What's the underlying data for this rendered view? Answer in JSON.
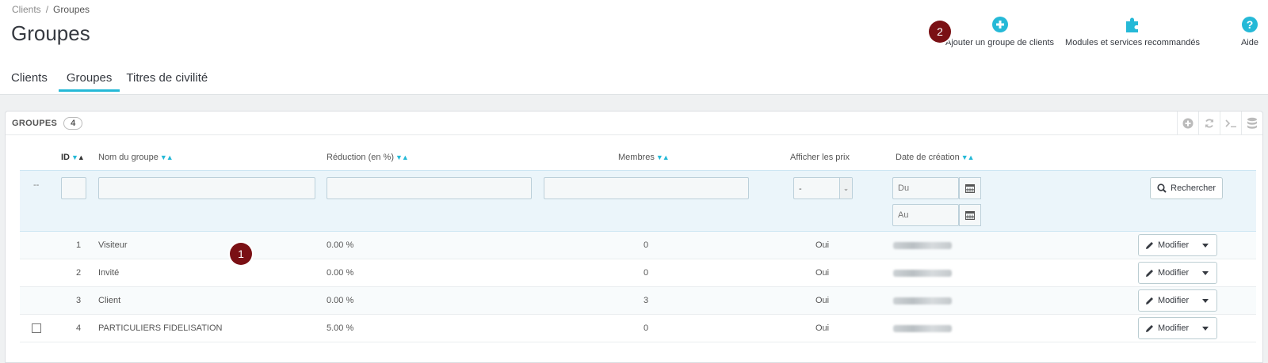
{
  "breadcrumb": {
    "parent": "Clients",
    "separator": "/",
    "current": "Groupes"
  },
  "page": {
    "title": "Groupes"
  },
  "toolbar": {
    "add_group": "Ajouter un groupe de clients",
    "modules": "Modules et services recommandés",
    "help": "Aide"
  },
  "tabs": [
    "Clients",
    "Groupes",
    "Titres de civilité"
  ],
  "markers": {
    "one": "1",
    "two": "2"
  },
  "panel": {
    "title": "GROUPES",
    "count": "4"
  },
  "columns": {
    "id": "ID",
    "name": "Nom du groupe",
    "reduction": "Réduction (en %)",
    "members": "Membres",
    "show_prices": "Afficher les prix",
    "date": "Date de création"
  },
  "filters": {
    "dash": "--",
    "show_prices_value": "-",
    "date_from_placeholder": "Du",
    "date_to_placeholder": "Au",
    "search_button": "Rechercher"
  },
  "rows": [
    {
      "id": "1",
      "name": "Visiteur",
      "reduction": "0.00 %",
      "members": "0",
      "show_prices": "Oui"
    },
    {
      "id": "2",
      "name": "Invité",
      "reduction": "0.00 %",
      "members": "0",
      "show_prices": "Oui"
    },
    {
      "id": "3",
      "name": "Client",
      "reduction": "0.00 %",
      "members": "3",
      "show_prices": "Oui"
    },
    {
      "id": "4",
      "name": "PARTICULIERS FIDELISATION",
      "reduction": "5.00 %",
      "members": "0",
      "show_prices": "Oui"
    }
  ],
  "row_action": "Modifier",
  "colors": {
    "accent": "#25b9d7",
    "marker": "#7a1014",
    "filter_bg": "#ebf5fa"
  }
}
